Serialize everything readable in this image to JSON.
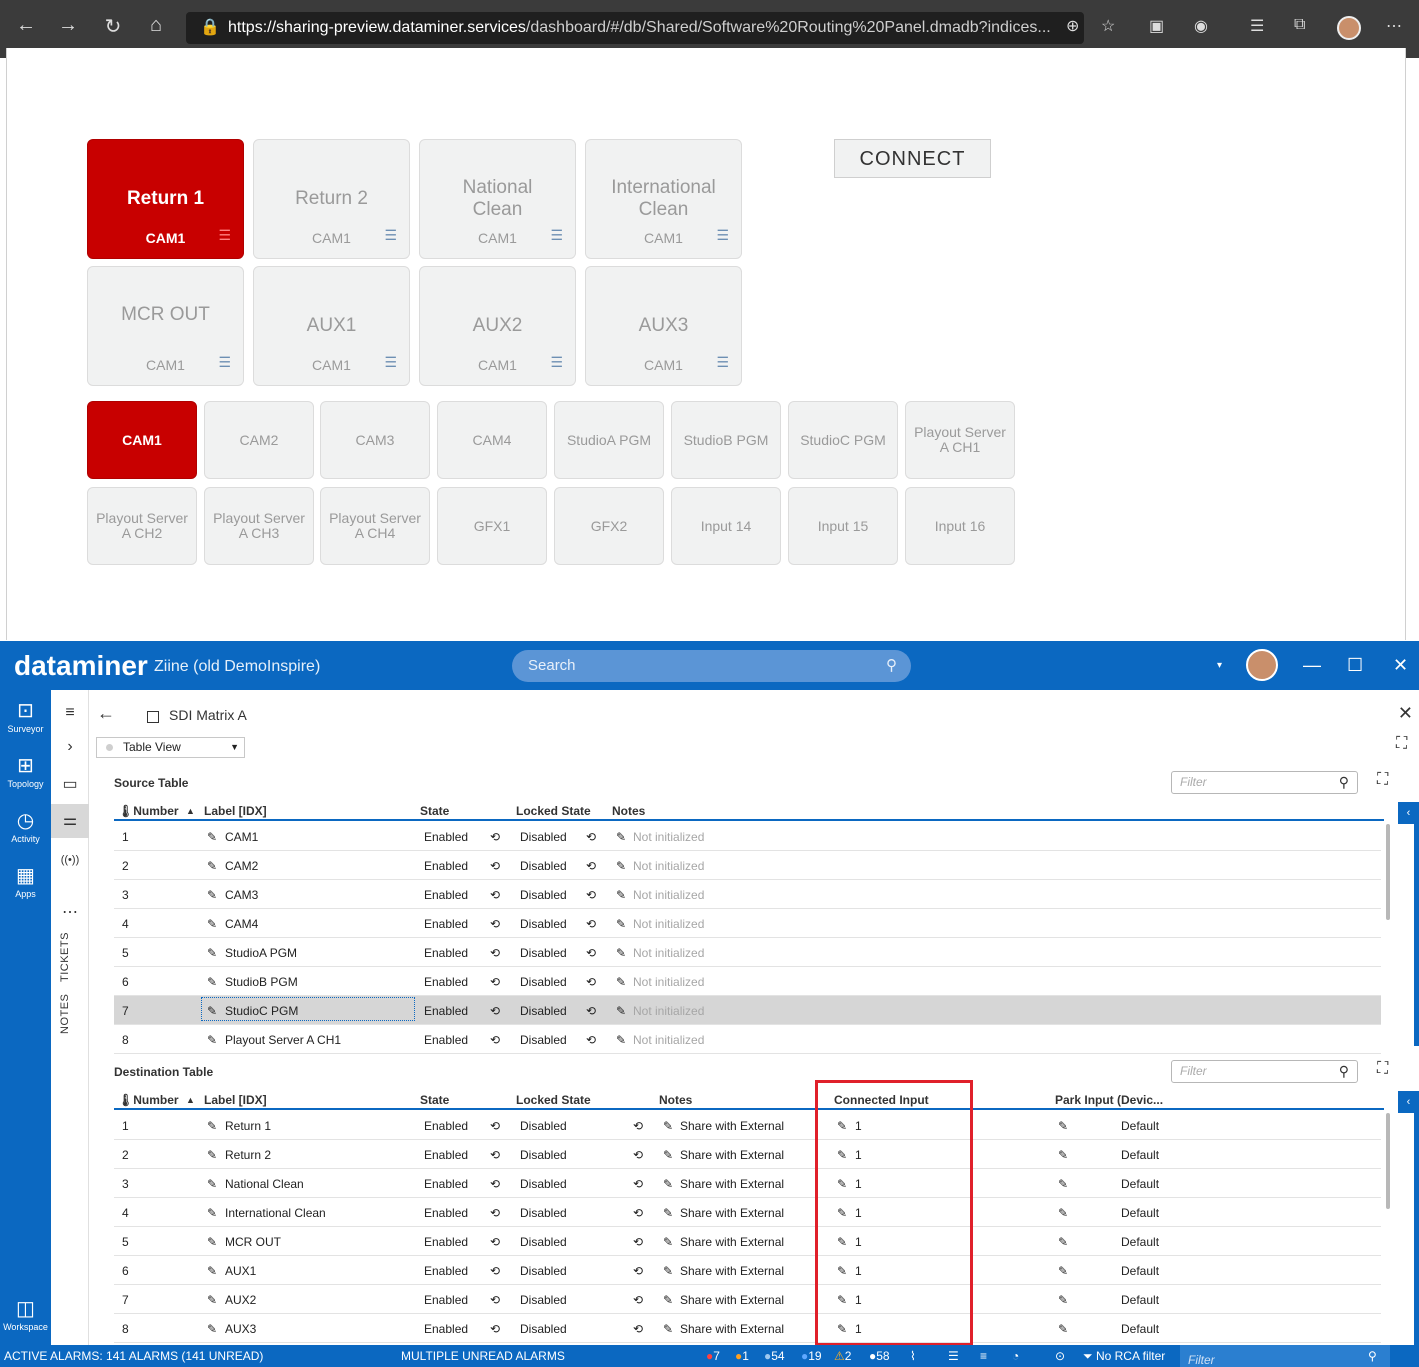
{
  "browser": {
    "url_host": "https://sharing-preview.dataminer.services",
    "url_path": "/dashboard/#/db/Shared/Software%20Routing%20Panel.dmadb?indices..."
  },
  "panel": {
    "destinations": [
      {
        "name": "Return 1",
        "source": "CAM1",
        "selected": true
      },
      {
        "name": "Return 2",
        "source": "CAM1",
        "selected": false
      },
      {
        "name": "National Clean",
        "source": "CAM1",
        "selected": false
      },
      {
        "name": "International Clean",
        "source": "CAM1",
        "selected": false
      },
      {
        "name": "MCR OUT",
        "source": "CAM1",
        "selected": false
      },
      {
        "name": "AUX1",
        "source": "CAM1",
        "selected": false
      },
      {
        "name": "AUX2",
        "source": "CAM1",
        "selected": false
      },
      {
        "name": "AUX3",
        "source": "CAM1",
        "selected": false
      }
    ],
    "connect_label": "CONNECT",
    "sources": [
      "CAM1",
      "CAM2",
      "CAM3",
      "CAM4",
      "StudioA PGM",
      "StudioB PGM",
      "StudioC PGM",
      "Playout Server A CH1",
      "Playout Server A CH2",
      "Playout Server A CH3",
      "Playout Server A CH4",
      "GFX1",
      "GFX2",
      "Input 14",
      "Input 15",
      "Input 16"
    ]
  },
  "app": {
    "logo": "dataminer",
    "system": "Ziine (old DemoInspire)",
    "search_placeholder": "Search",
    "nav": [
      "Surveyor",
      "Topology",
      "Activity",
      "Apps"
    ],
    "workspace": "Workspace",
    "tickets": "TICKETS",
    "notes": "NOTES",
    "element_name": "SDI Matrix A",
    "view_label": "Table View"
  },
  "source_table": {
    "title": "Source Table",
    "filter_placeholder": "Filter",
    "headers": {
      "number": "Number",
      "label": "Label [IDX]",
      "state": "State",
      "locked": "Locked State",
      "notes": "Notes"
    },
    "rows": [
      {
        "number": "1",
        "label": "CAM1",
        "state": "Enabled",
        "locked": "Disabled",
        "notes": "Not initialized"
      },
      {
        "number": "2",
        "label": "CAM2",
        "state": "Enabled",
        "locked": "Disabled",
        "notes": "Not initialized"
      },
      {
        "number": "3",
        "label": "CAM3",
        "state": "Enabled",
        "locked": "Disabled",
        "notes": "Not initialized"
      },
      {
        "number": "4",
        "label": "CAM4",
        "state": "Enabled",
        "locked": "Disabled",
        "notes": "Not initialized"
      },
      {
        "number": "5",
        "label": "StudioA PGM",
        "state": "Enabled",
        "locked": "Disabled",
        "notes": "Not initialized"
      },
      {
        "number": "6",
        "label": "StudioB PGM",
        "state": "Enabled",
        "locked": "Disabled",
        "notes": "Not initialized"
      },
      {
        "number": "7",
        "label": "StudioC PGM",
        "state": "Enabled",
        "locked": "Disabled",
        "notes": "Not initialized",
        "selected": true
      },
      {
        "number": "8",
        "label": "Playout Server A CH1",
        "state": "Enabled",
        "locked": "Disabled",
        "notes": "Not initialized"
      }
    ]
  },
  "destination_table": {
    "title": "Destination Table",
    "filter_placeholder": "Filter",
    "headers": {
      "number": "Number",
      "label": "Label [IDX]",
      "state": "State",
      "locked": "Locked State",
      "notes": "Notes",
      "connected": "Connected Input",
      "park": "Park Input (Devic..."
    },
    "rows": [
      {
        "number": "1",
        "label": "Return 1",
        "state": "Enabled",
        "locked": "Disabled",
        "notes": "Share with External",
        "connected": "1",
        "park": "Default"
      },
      {
        "number": "2",
        "label": "Return 2",
        "state": "Enabled",
        "locked": "Disabled",
        "notes": "Share with External",
        "connected": "1",
        "park": "Default"
      },
      {
        "number": "3",
        "label": "National Clean",
        "state": "Enabled",
        "locked": "Disabled",
        "notes": "Share with External",
        "connected": "1",
        "park": "Default"
      },
      {
        "number": "4",
        "label": "International Clean",
        "state": "Enabled",
        "locked": "Disabled",
        "notes": "Share with External",
        "connected": "1",
        "park": "Default"
      },
      {
        "number": "5",
        "label": "MCR OUT",
        "state": "Enabled",
        "locked": "Disabled",
        "notes": "Share with External",
        "connected": "1",
        "park": "Default"
      },
      {
        "number": "6",
        "label": "AUX1",
        "state": "Enabled",
        "locked": "Disabled",
        "notes": "Share with External",
        "connected": "1",
        "park": "Default"
      },
      {
        "number": "7",
        "label": "AUX2",
        "state": "Enabled",
        "locked": "Disabled",
        "notes": "Share with External",
        "connected": "1",
        "park": "Default"
      },
      {
        "number": "8",
        "label": "AUX3",
        "state": "Enabled",
        "locked": "Disabled",
        "notes": "Share with External",
        "connected": "1",
        "park": "Default"
      }
    ]
  },
  "statusbar": {
    "active_alarms": "ACTIVE ALARMS: 141 ALARMS (141 UNREAD)",
    "unread": "MULTIPLE UNREAD ALARMS",
    "counts": [
      "7",
      "1",
      "54",
      "19",
      "2",
      "58"
    ],
    "rca": "No RCA filter",
    "filter_placeholder": "Filter"
  },
  "colors": {
    "accent": "#0b68c1",
    "selected": "#c80000",
    "highlight_box": "#e0202a"
  }
}
